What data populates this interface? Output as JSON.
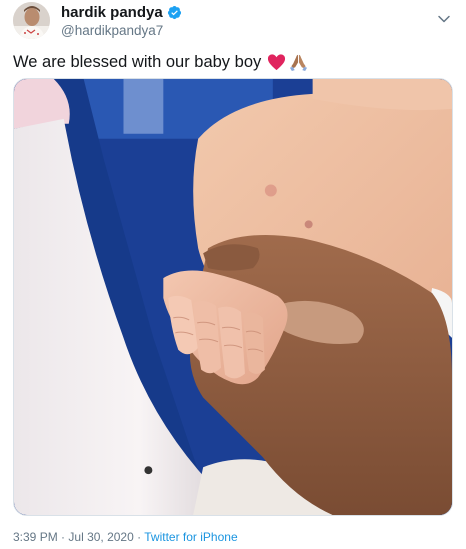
{
  "user": {
    "display_name": "hardik pandya",
    "handle": "@hardikpandya7",
    "verified_icon": "verified-badge-icon",
    "avatar_icon": "profile-avatar"
  },
  "tweet": {
    "text": "We are blessed with our baby boy",
    "emojis": [
      "red-heart-icon",
      "folded-hands-icon"
    ],
    "media_description_icon": "photo-newborn-hand"
  },
  "footer": {
    "time": "3:39 PM",
    "separator": "·",
    "date": "Jul 30, 2020",
    "source": "Twitter for iPhone"
  },
  "colors": {
    "text_primary": "#14171a",
    "text_secondary": "#657786",
    "link": "#1b95e0",
    "verified": "#1da1f2",
    "heart": "#e0245e"
  }
}
